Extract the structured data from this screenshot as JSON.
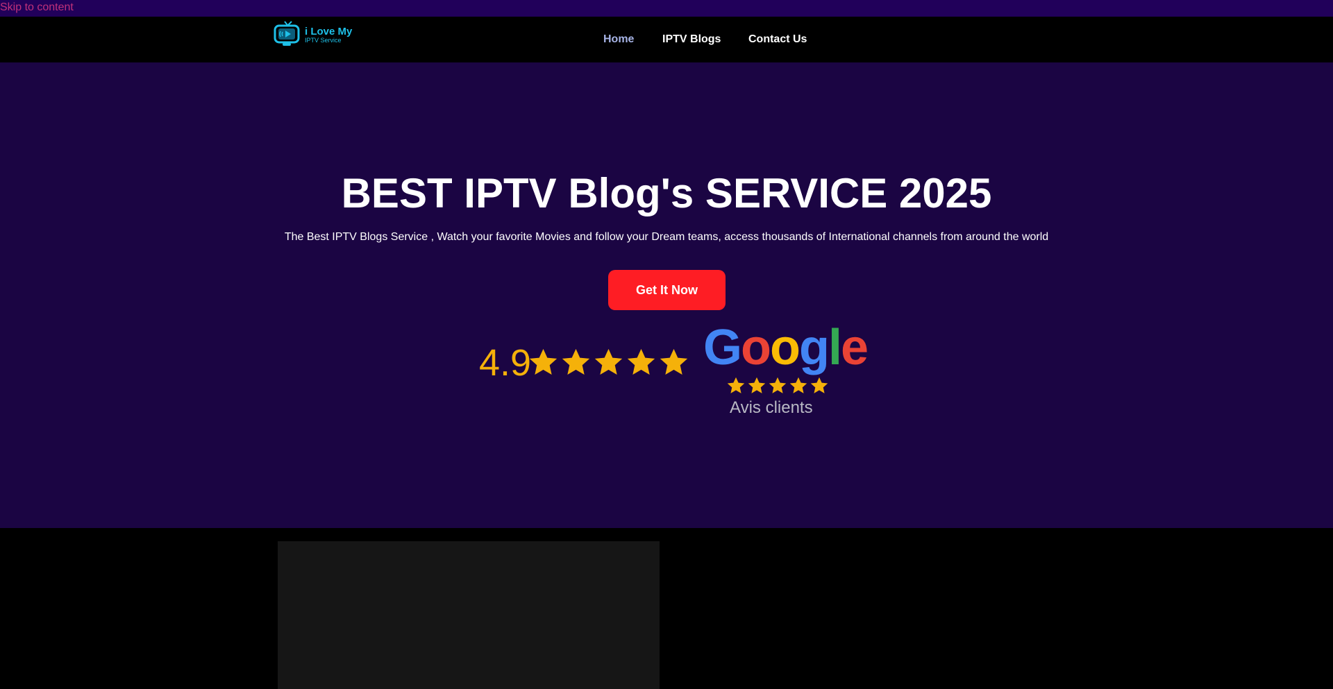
{
  "skip_link": {
    "label": "Skip to content"
  },
  "header": {
    "logo": {
      "line1": "i Love My",
      "line2": "IPTV Service"
    },
    "nav": [
      {
        "label": "Home",
        "active": true
      },
      {
        "label": "IPTV Blogs",
        "active": false
      },
      {
        "label": "Contact Us",
        "active": false
      }
    ]
  },
  "hero": {
    "title": "BEST IPTV Blog's SERVICE 2025",
    "subtitle": "The Best IPTV Blogs Service , Watch your favorite Movies and follow your Dream teams, access thousands of International channels from around the world",
    "cta_label": "Get It Now",
    "rating": {
      "score": "4.9",
      "stars": 5,
      "google": {
        "G": "G",
        "o1": "o",
        "o2": "o",
        "g": "g",
        "l": "l",
        "e": "e"
      },
      "google_stars": 5,
      "caption": "Avis clients"
    }
  },
  "colors": {
    "hero_bg": "#1b0543",
    "accent": "#fe1d24",
    "star": "#f5b10a",
    "nav_active": "#a7b4e6",
    "skip_bar": "#21005a"
  },
  "icons": {
    "logo": "tv-icon",
    "star": "star-icon"
  }
}
